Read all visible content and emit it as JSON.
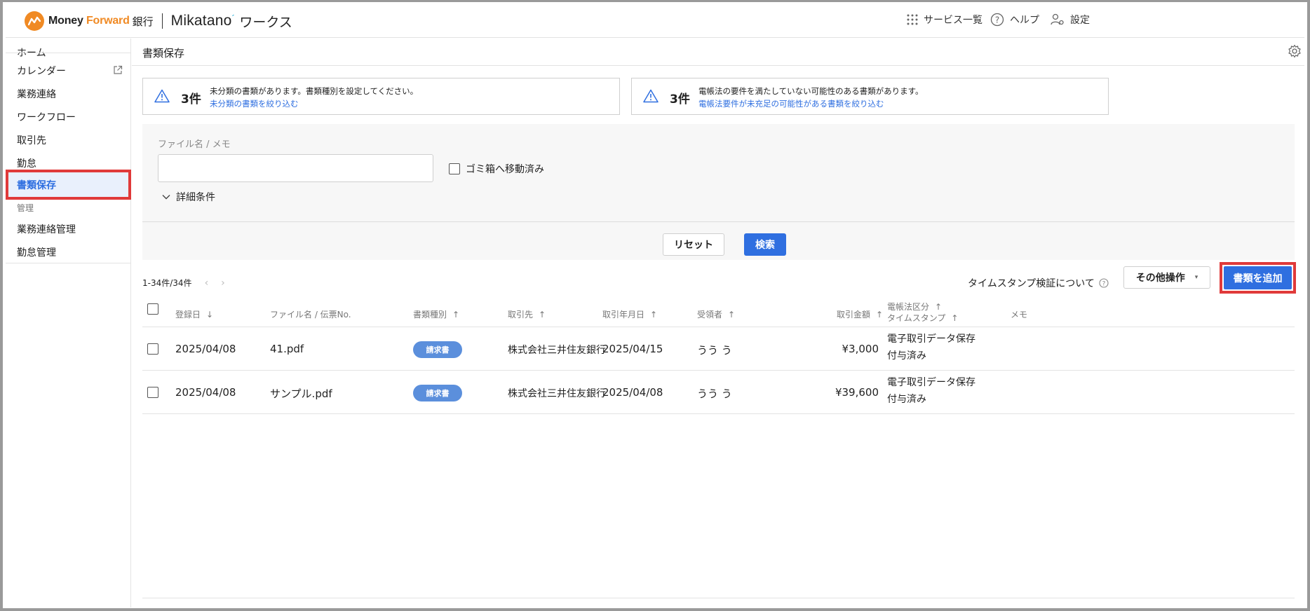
{
  "header": {
    "brand_mf": "Money",
    "brand_fw": "Forward",
    "brand_bank": "銀行",
    "brand_mikatano": "Mikatano",
    "brand_works": "ワークス",
    "services_label": "サービス一覧",
    "help_label": "ヘルプ",
    "settings_label": "設定"
  },
  "sidebar": {
    "items": [
      {
        "label": "ホーム"
      },
      {
        "label": "カレンダー"
      },
      {
        "label": "業務連絡"
      },
      {
        "label": "ワークフロー"
      },
      {
        "label": "取引先"
      },
      {
        "label": "勤怠"
      },
      {
        "label": "書類保存"
      }
    ],
    "group_label": "管理",
    "admin_items": [
      {
        "label": "業務連絡管理"
      },
      {
        "label": "勤怠管理"
      }
    ]
  },
  "page": {
    "title": "書類保存"
  },
  "alerts": [
    {
      "count": "3件",
      "message": "未分類の書類があります。書類種別を設定してください。",
      "link": "未分類の書類を絞り込む"
    },
    {
      "count": "3件",
      "message": "電帳法の要件を満たしていない可能性のある書類があります。",
      "link": "電帳法要件が未充足の可能性がある書類を絞り込む"
    }
  ],
  "search": {
    "field_label": "ファイル名 / メモ",
    "field_value": "",
    "trash_label": "ゴミ箱へ移動済み",
    "detail_label": "詳細条件",
    "reset_label": "リセット",
    "search_label": "検索"
  },
  "toolbar": {
    "pager_text": "1-34件/34件",
    "timestamp_label": "タイムスタンプ検証について",
    "other_ops_label": "その他操作",
    "add_label": "書類を追加"
  },
  "table": {
    "headers": {
      "registered": "登録日",
      "filename": "ファイル名 / 伝票No.",
      "doctype": "書類種別",
      "partner": "取引先",
      "txdate": "取引年月日",
      "receiver": "受領者",
      "amount": "取引金額",
      "ebook": "電帳法区分",
      "timestamp": "タイムスタンプ",
      "memo": "メモ"
    },
    "rows": [
      {
        "registered": "2025/04/08",
        "filename": "41.pdf",
        "doctype": "請求書",
        "partner": "株式会社三井住友銀行",
        "txdate": "2025/04/15",
        "receiver": "うう う",
        "amount": "¥3,000",
        "ebook": "電子取引データ保存",
        "timestamp": "付与済み"
      },
      {
        "registered": "2025/04/08",
        "filename": "サンプル.pdf",
        "doctype": "請求書",
        "partner": "株式会社三井住友銀行",
        "txdate": "2025/04/08",
        "receiver": "うう う",
        "amount": "¥39,600",
        "ebook": "電子取引データ保存",
        "timestamp": "付与済み"
      }
    ]
  },
  "colors": {
    "accent": "#2f6fe0",
    "highlight_border": "#e03a3a",
    "brand_orange": "#f08a24"
  }
}
